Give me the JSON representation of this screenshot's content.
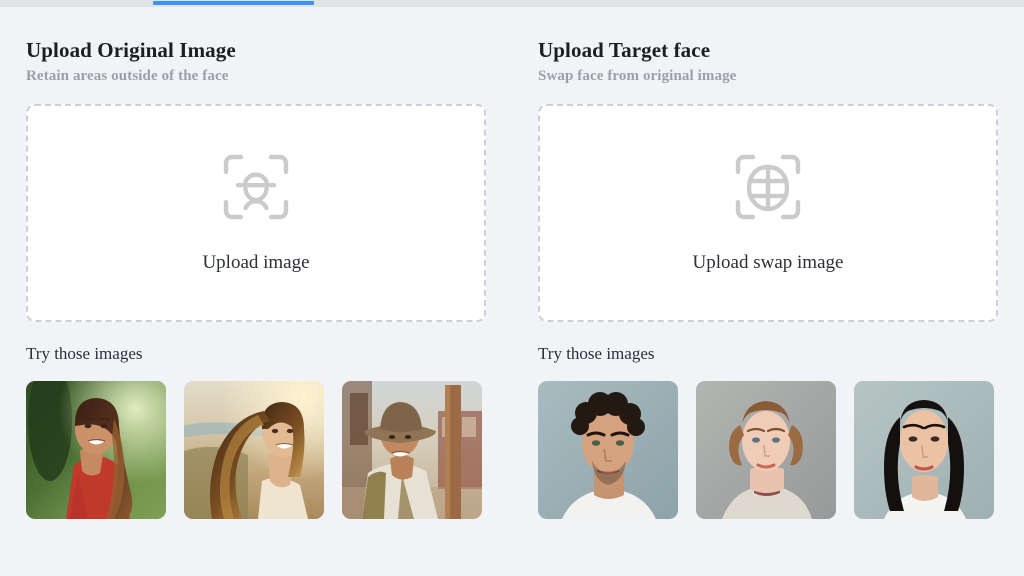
{
  "tabs": {
    "active_indicator_color": "#3b94f5",
    "strip_color": "#e2e3e5"
  },
  "theme": {
    "page_background": "#f1f3f6",
    "dropzone_background": "#ffffff",
    "dropzone_border": "#ccd0d6",
    "heading_color": "#1c1e23",
    "subtitle_color": "#9aa0a8",
    "body_text_color": "#2b2f36"
  },
  "panels": [
    {
      "title": "Upload Original Image",
      "subtitle": "Retain areas outside of the face",
      "dropzone": {
        "label": "Upload image",
        "icon": "face-scan-frame-icon"
      },
      "samples_label": "Try those images",
      "thumbnails": [
        {
          "name": "smiling-woman-red-top-jungle"
        },
        {
          "name": "woman-windswept-hair-beach-sunset"
        },
        {
          "name": "cowboy-man-western-town"
        }
      ]
    },
    {
      "title": "Upload Target face",
      "subtitle": "Swap face from original image",
      "dropzone": {
        "label": "Upload swap image",
        "icon": "face-mesh-frame-icon"
      },
      "samples_label": "Try those images",
      "thumbnails": [
        {
          "name": "man-curly-dark-hair-portrait"
        },
        {
          "name": "young-woman-auburn-hair-portrait"
        },
        {
          "name": "east-asian-woman-black-hair-portrait"
        }
      ]
    }
  ]
}
